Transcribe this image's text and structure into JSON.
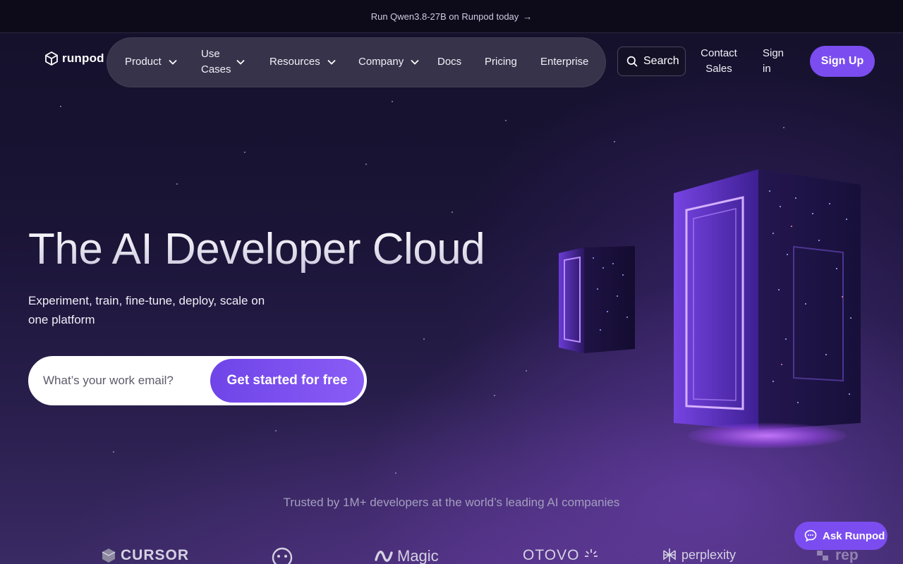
{
  "announcement": {
    "text": "Run Qwen3.8-27B on Runpod today",
    "arrow": "→"
  },
  "brand": {
    "name": "runpod"
  },
  "nav": {
    "items": [
      {
        "label": "Product",
        "dropdown": true
      },
      {
        "label": "Use Cases",
        "dropdown": true
      },
      {
        "label": "Resources",
        "dropdown": true
      },
      {
        "label": "Company",
        "dropdown": true
      },
      {
        "label": "Docs",
        "dropdown": false
      },
      {
        "label": "Pricing",
        "dropdown": false
      },
      {
        "label": "Enterprise",
        "dropdown": false
      }
    ],
    "search_label": "Search",
    "contact_label": "Contact Sales",
    "signin_label": "Sign in",
    "signup_label": "Sign Up"
  },
  "hero": {
    "title": "The AI Developer Cloud",
    "subtitle": "Experiment, train, fine-tune, deploy, scale on one platform",
    "email_placeholder": "What’s your work email?",
    "cta_label": "Get started for free"
  },
  "trusted": {
    "text": "Trusted by 1M+ developers at the world’s leading AI companies",
    "logos": [
      "CURSOR",
      "",
      "Magic",
      "OTOVO",
      "perplexity",
      "rep"
    ]
  },
  "chat": {
    "label": "Ask Runpod"
  },
  "colors": {
    "accent": "#7b4df0",
    "background": "#14102a"
  }
}
